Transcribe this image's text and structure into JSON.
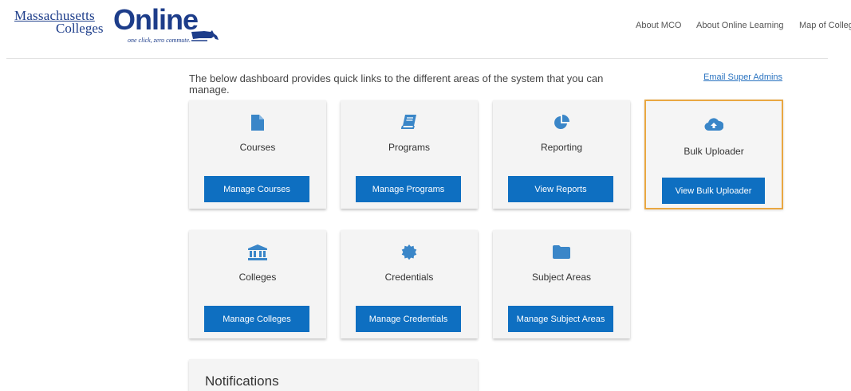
{
  "brand": {
    "line1": "Massachusetts",
    "line2": "Colleges",
    "wordmark": "Online",
    "tagline": "one click, zero commute.",
    "color": "#1d3d8a"
  },
  "nav": {
    "items": [
      "About MCO",
      "About Online Learning",
      "Map of Colleg"
    ]
  },
  "intro": "The below dashboard provides quick links to the different areas of the system that you can manage.",
  "email_link": "Email Super Admins",
  "cards": [
    {
      "title": "Courses",
      "button": "Manage Courses",
      "icon": "file-icon"
    },
    {
      "title": "Programs",
      "button": "Manage Programs",
      "icon": "book-icon"
    },
    {
      "title": "Reporting",
      "button": "View Reports",
      "icon": "pie-chart-icon"
    },
    {
      "title": "Bulk Uploader",
      "button": "View Bulk Uploader",
      "icon": "cloud-upload-icon"
    },
    {
      "title": "Colleges",
      "button": "Manage Colleges",
      "icon": "institution-icon"
    },
    {
      "title": "Credentials",
      "button": "Manage Credentials",
      "icon": "certificate-icon"
    },
    {
      "title": "Subject Areas",
      "button": "Manage Subject Areas",
      "icon": "folder-icon"
    }
  ],
  "notifications_title": "Notifications",
  "colors": {
    "accent": "#0e6fc1",
    "icon": "#3a86c8",
    "highlight": "#e9a741",
    "link": "#2a73c0"
  }
}
